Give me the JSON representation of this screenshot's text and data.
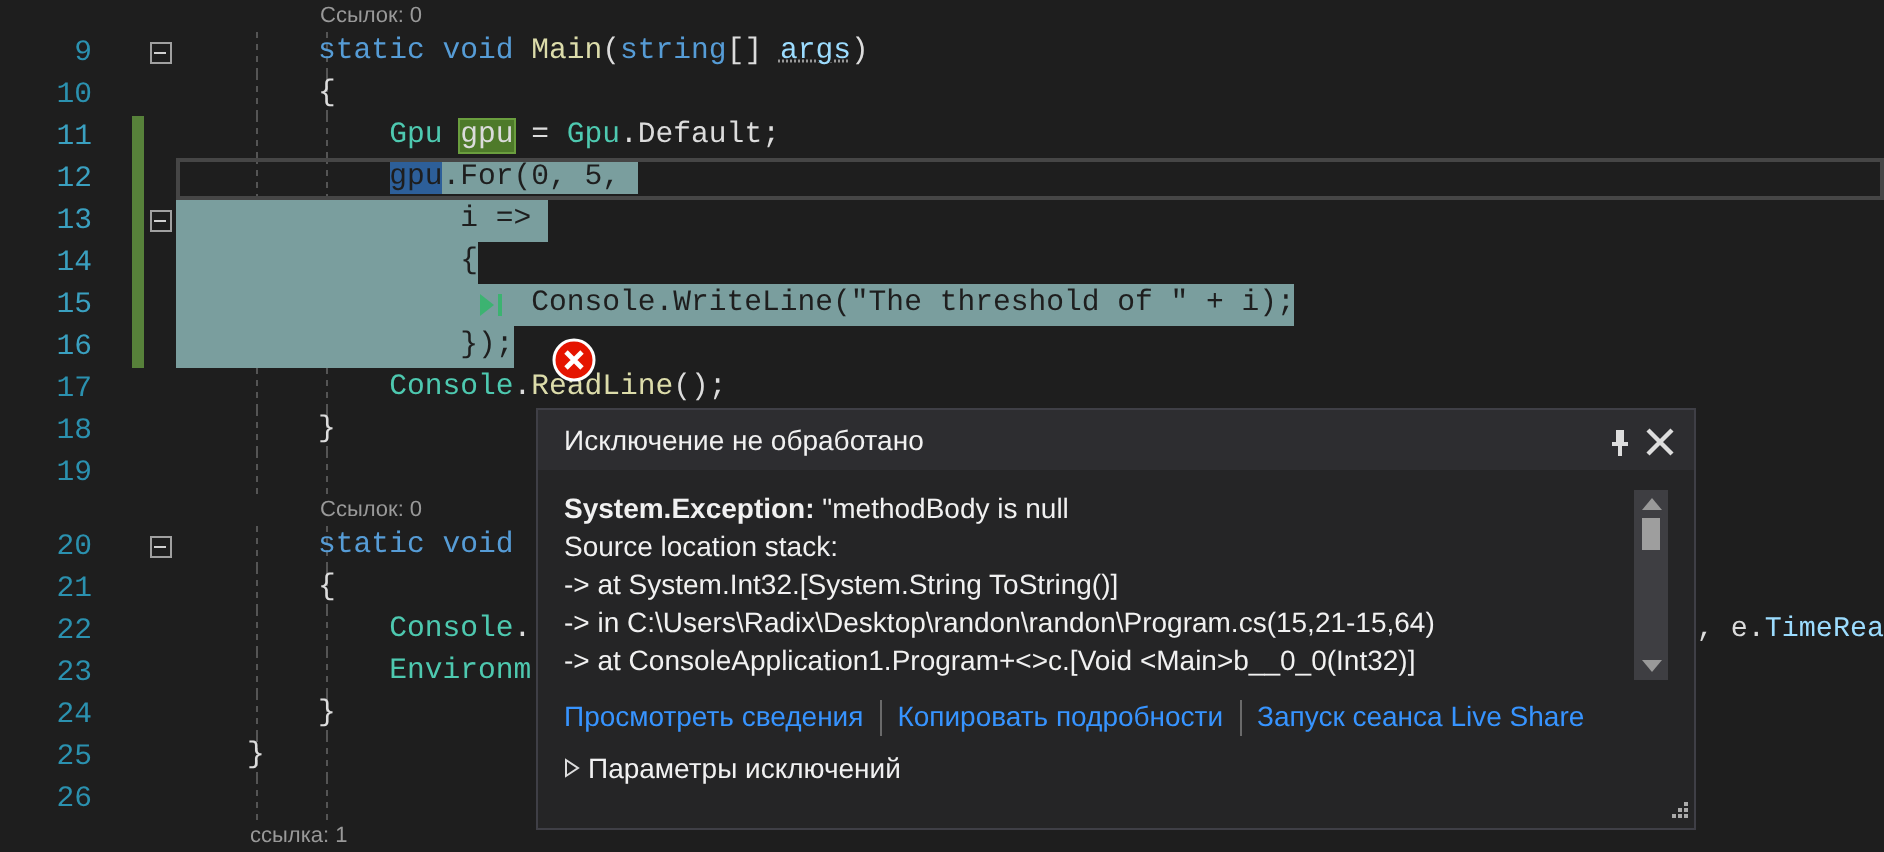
{
  "editor": {
    "rows": [
      {
        "kind": "lens_member",
        "text": "Ссылок: 0"
      },
      {
        "kind": "code",
        "number": "9",
        "changed": false,
        "folding": true,
        "current": false,
        "selected": false,
        "tokens": [
          {
            "text": "        static void ",
            "kind": "keyword"
          },
          {
            "text": "Main",
            "kind": "method"
          },
          {
            "text": "(",
            "kind": "plain"
          },
          {
            "text": "string",
            "kind": "keyword"
          },
          {
            "text": "[] ",
            "kind": "plain"
          },
          {
            "text": "args",
            "kind": "param",
            "hint": true
          },
          {
            "text": ")",
            "kind": "plain"
          }
        ]
      },
      {
        "kind": "code",
        "number": "10",
        "changed": false,
        "current": false,
        "selected": false,
        "tokens": [
          {
            "text": "        {",
            "kind": "plain"
          }
        ]
      },
      {
        "kind": "code",
        "number": "11",
        "changed": true,
        "current": false,
        "selected": false,
        "tokens": [
          {
            "text": "            Gpu ",
            "kind": "type"
          },
          {
            "text": "gpu",
            "kind": "plain",
            "write_highlight": true
          },
          {
            "text": " = ",
            "kind": "plain"
          },
          {
            "text": "Gpu",
            "kind": "type"
          },
          {
            "text": ".Default;",
            "kind": "plain"
          }
        ]
      },
      {
        "kind": "code",
        "number": "12",
        "changed": true,
        "current": true,
        "selected": false,
        "tokens": [
          {
            "text": "            gpu",
            "kind": "plain",
            "read_highlight": true,
            "selected": true
          },
          {
            "text": ".For(0, 5, ",
            "kind": "plain",
            "selected": true
          }
        ]
      },
      {
        "kind": "code",
        "number": "13",
        "changed": true,
        "folding": true,
        "current": false,
        "selected": true,
        "tokens": [
          {
            "text": "                i => ",
            "kind": "plain"
          }
        ]
      },
      {
        "kind": "code",
        "number": "14",
        "changed": true,
        "current": false,
        "selected": true,
        "tokens": [
          {
            "text": "                {",
            "kind": "plain"
          }
        ]
      },
      {
        "kind": "code",
        "number": "15",
        "changed": true,
        "current": false,
        "selected": true,
        "run_marker": true,
        "tokens": [
          {
            "text": "                    Console.WriteLine(\"The threshold of \" + i);",
            "kind": "plain"
          }
        ]
      },
      {
        "kind": "code",
        "number": "16",
        "changed": true,
        "current": false,
        "selected": true,
        "error_marker": true,
        "tokens": [
          {
            "text": "                });",
            "kind": "plain"
          }
        ]
      },
      {
        "kind": "code",
        "number": "17",
        "changed": false,
        "current": false,
        "selected": false,
        "tokens": [
          {
            "text": "            Console",
            "kind": "type"
          },
          {
            "text": ".",
            "kind": "plain"
          },
          {
            "text": "ReadLine",
            "kind": "method"
          },
          {
            "text": "();",
            "kind": "plain"
          }
        ]
      },
      {
        "kind": "code",
        "number": "18",
        "changed": false,
        "current": false,
        "selected": false,
        "tokens": [
          {
            "text": "        }",
            "kind": "plain"
          }
        ]
      },
      {
        "kind": "code",
        "number": "19",
        "changed": false,
        "current": false,
        "selected": false,
        "tokens": []
      },
      {
        "kind": "lens_member",
        "text": "Ссылок: 0"
      },
      {
        "kind": "code",
        "number": "20",
        "changed": false,
        "folding": true,
        "current": false,
        "selected": false,
        "tokens": [
          {
            "text": "        static void",
            "kind": "keyword"
          }
        ]
      },
      {
        "kind": "code",
        "number": "21",
        "changed": false,
        "current": false,
        "selected": false,
        "tokens": [
          {
            "text": "        {",
            "kind": "plain"
          }
        ]
      },
      {
        "kind": "code",
        "number": "22",
        "changed": false,
        "current": false,
        "selected": false,
        "tokens": [
          {
            "text": "            Console",
            "kind": "type"
          },
          {
            "text": ".",
            "kind": "plain"
          }
        ],
        "tail": [
          {
            "text": ", e.",
            "kind": "plain"
          },
          {
            "text": "TimeRea",
            "kind": "param"
          }
        ]
      },
      {
        "kind": "code",
        "number": "23",
        "changed": false,
        "current": false,
        "selected": false,
        "tokens": [
          {
            "text": "            Environm",
            "kind": "type"
          }
        ]
      },
      {
        "kind": "code",
        "number": "24",
        "changed": false,
        "current": false,
        "selected": false,
        "tokens": [
          {
            "text": "        }",
            "kind": "plain"
          }
        ]
      },
      {
        "kind": "code",
        "number": "25",
        "changed": false,
        "current": false,
        "selected": false,
        "tokens": [
          {
            "text": "    }",
            "kind": "plain"
          }
        ]
      },
      {
        "kind": "code",
        "number": "26",
        "changed": false,
        "current": false,
        "selected": false,
        "tokens": []
      },
      {
        "kind": "lens_type",
        "text": "ссылка: 1"
      }
    ]
  },
  "exception_popup": {
    "title": "Исключение не обработано",
    "details": [
      "**System.Exception:** \"methodBody is null",
      "Source location stack:",
      "-> at System.Int32.[System.String ToString()]",
      "-> in C:\\Users\\Radix\\Desktop\\randon\\randon\\Program.cs(15,21-15,64)",
      "-> at ConsoleApplication1.Program+<>c.[Void <Main>b__0_0(Int32)]"
    ],
    "links": [
      "Просмотреть сведения",
      "Копировать подробности",
      "Запуск сеанса Live Share"
    ],
    "settings": {
      "label": "Параметры исключений",
      "expanded": false
    }
  }
}
